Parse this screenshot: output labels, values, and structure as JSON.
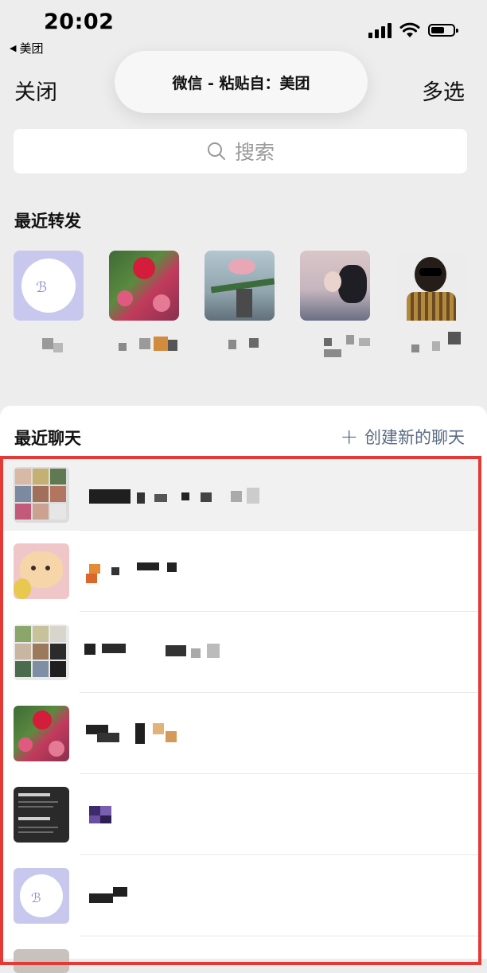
{
  "status_bar": {
    "time": "20:02",
    "back_app": "美团",
    "signal_icon": "cellular-signal-icon",
    "wifi_icon": "wifi-icon",
    "battery_icon": "battery-icon",
    "battery_level": 0.6
  },
  "header": {
    "paste_notice": "微信 - 粘贴自：美团",
    "close_label": "关闭",
    "multi_select_label": "多选"
  },
  "search": {
    "placeholder": "搜索",
    "icon": "search-icon"
  },
  "recent_forward": {
    "title": "最近转发",
    "items": [
      {
        "name_redacted": true,
        "avatar": "lavender-logo"
      },
      {
        "name_redacted": true,
        "avatar": "red-flowers"
      },
      {
        "name_redacted": true,
        "avatar": "flower-cup"
      },
      {
        "name_redacted": true,
        "avatar": "woman-portrait"
      },
      {
        "name_redacted": true,
        "avatar": "child-sunglasses"
      }
    ]
  },
  "recent_chats": {
    "title": "最近聊天",
    "new_chat_label": "创建新的聊天",
    "new_chat_icon": "plus-icon",
    "chats": [
      {
        "name_redacted": true,
        "avatar": "group-grid"
      },
      {
        "name_redacted": true,
        "avatar": "cartoon-bear"
      },
      {
        "name_redacted": true,
        "avatar": "group-grid-2"
      },
      {
        "name_redacted": true,
        "avatar": "red-flowers"
      },
      {
        "name_redacted": true,
        "avatar": "dark-text-card"
      },
      {
        "name_redacted": true,
        "avatar": "lavender-logo"
      }
    ]
  },
  "colors": {
    "background": "#ededed",
    "highlight": "#e53935",
    "link": "#5b6b86"
  }
}
